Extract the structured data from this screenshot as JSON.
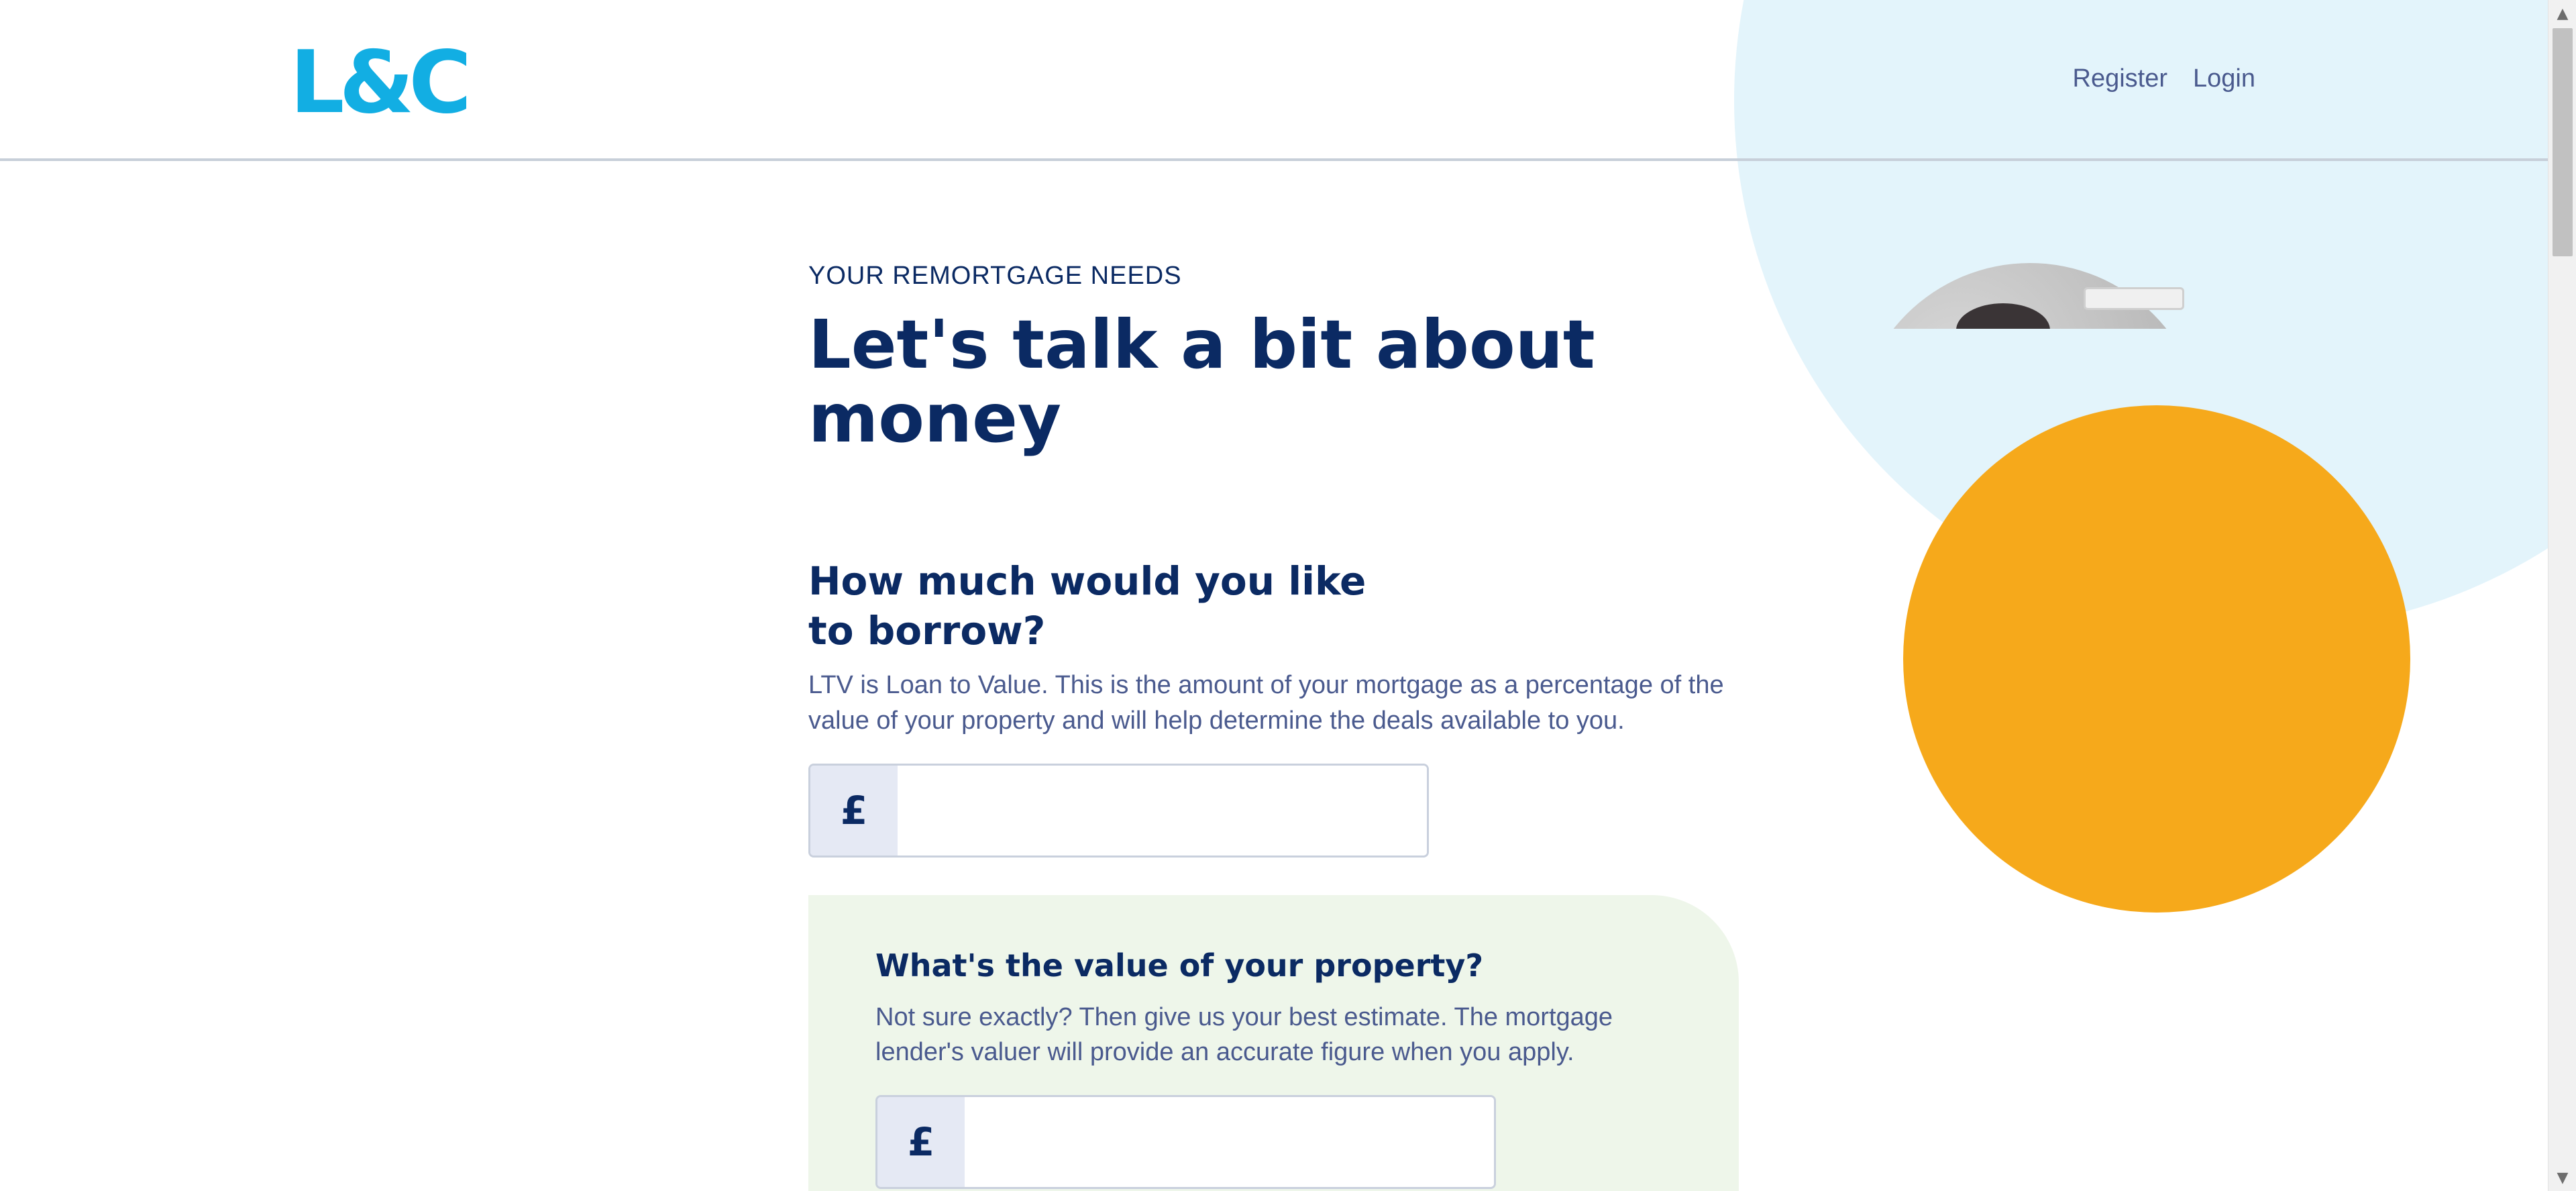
{
  "header": {
    "logo_text": "L&C",
    "nav": {
      "register_label": "Register",
      "login_label": "Login"
    }
  },
  "main": {
    "eyebrow": "YOUR REMORTGAGE NEEDS",
    "title": "Let's talk a bit about money",
    "borrow": {
      "question": "How much would you like to borrow?",
      "description": "LTV is Loan to Value. This is the amount of your mortgage as a percentage of the value of your property and will help determine the deals available to you.",
      "currency_symbol": "£",
      "value": ""
    },
    "property": {
      "question": "What's the value of your property?",
      "description": "Not sure exactly? Then give us your best estimate. The mortgage lender's valuer will provide an accurate figure when you apply.",
      "currency_symbol": "£",
      "value": ""
    }
  },
  "colors": {
    "brand_blue": "#12aee3",
    "navy": "#0b2a63",
    "orange": "#f6a91b",
    "light_blue_bg": "#e3f4fb",
    "card_green": "#eef6ea"
  },
  "scrollbar": {
    "up_icon": "triangle-up-icon",
    "down_icon": "triangle-down-icon"
  }
}
